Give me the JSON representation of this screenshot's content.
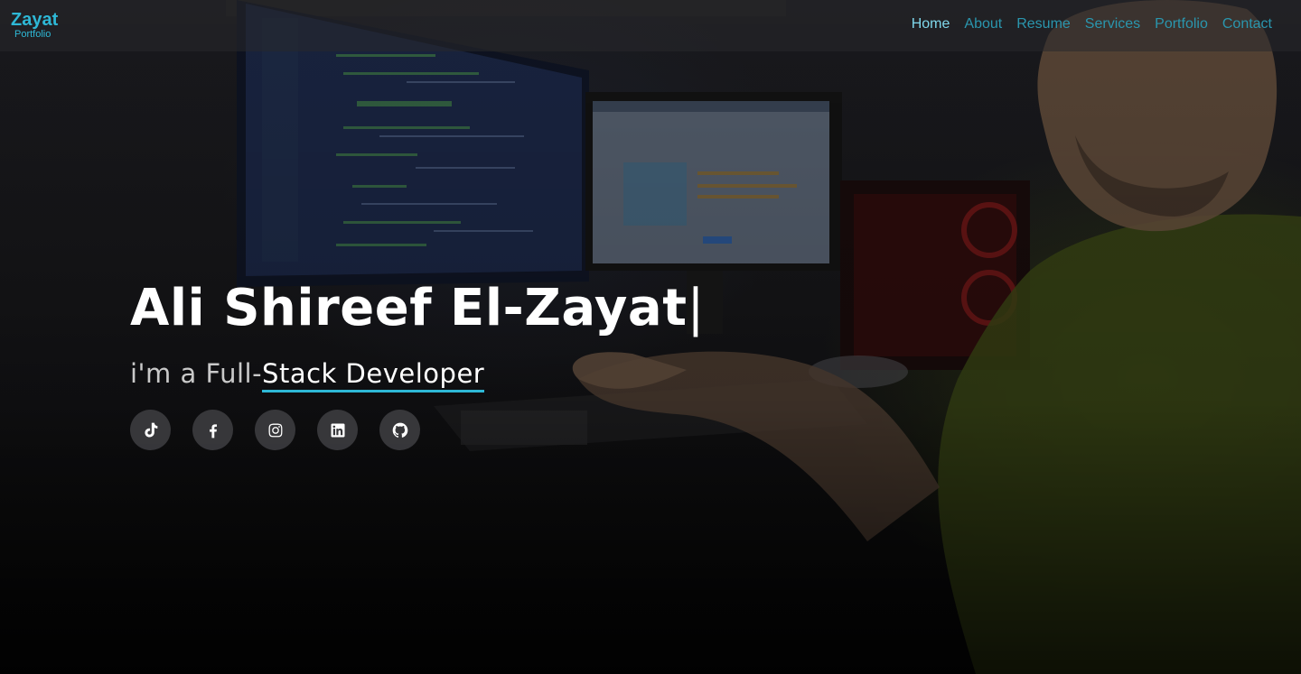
{
  "brand": {
    "name": "Zayat",
    "subtitle": "Portfolio"
  },
  "nav": {
    "items": [
      {
        "label": "Home",
        "active": true
      },
      {
        "label": "About",
        "active": false
      },
      {
        "label": "Resume",
        "active": false
      },
      {
        "label": "Services",
        "active": false
      },
      {
        "label": "Portfolio",
        "active": false
      },
      {
        "label": "Contact",
        "active": false
      }
    ]
  },
  "hero": {
    "name": "Ali Shireef El-Zayat",
    "cursor": "|",
    "tagline_prefix": "i'm a Full-",
    "tagline_highlight": "Stack Developer"
  },
  "socials": [
    {
      "name": "tiktok-icon"
    },
    {
      "name": "facebook-icon"
    },
    {
      "name": "instagram-icon"
    },
    {
      "name": "linkedin-icon"
    },
    {
      "name": "github-icon"
    }
  ],
  "colors": {
    "accent": "#2eb8d6",
    "nav_link": "#2a96ae",
    "nav_active": "#7fd8ec"
  }
}
